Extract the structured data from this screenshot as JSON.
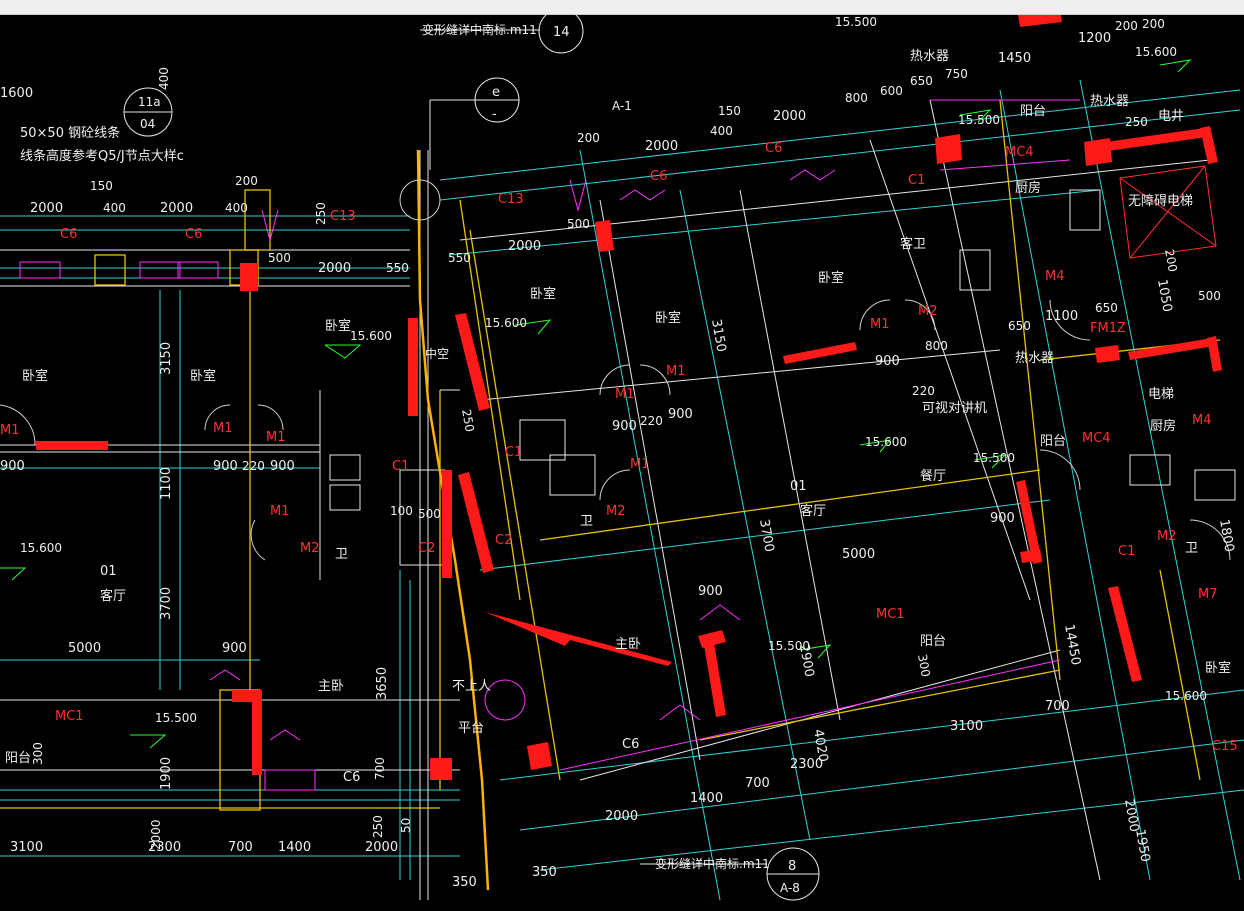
{
  "window": {
    "title": ""
  },
  "drawing": {
    "annotations": {
      "detail_top": "变形缝详中南标.m11",
      "detail_bottom": "变形缝详中南标.m11",
      "bubble_14": "14",
      "bubble_e": "e",
      "bubble_e_sub": "-",
      "bubble_11a": "11a",
      "bubble_04": "04",
      "bubble_8": "8",
      "bubble_a8": "A-8",
      "a1": "A-1",
      "note_line1": "50×50 钢砼线条",
      "note_line2": "线条高度参考Q5/J节点大样c"
    },
    "rooms": {
      "bedroom": "卧室",
      "living": "客厅",
      "kitchen": "厨房",
      "balcony": "阳台",
      "master": "主卧",
      "dining": "餐厅",
      "guest_bath": "客卫",
      "bath": "卫",
      "void": "中空",
      "no_roof": "不上人",
      "platform": "平台",
      "water_heater": "热水器",
      "pipe_shaft": "电井",
      "elevator": "无障碍电梯",
      "elevator_short": "电梯",
      "intercom": "可视对讲机",
      "unit_01": "01"
    },
    "tags": {
      "C6": "C6",
      "C13": "C13",
      "C1": "C1",
      "C2": "C2",
      "C15": "C15",
      "M1": "M1",
      "M2": "M2",
      "M4": "M4",
      "MC1": "MC1",
      "MC4": "MC4",
      "FM1Z": "FM1Z",
      "M7": "M7"
    },
    "levels": {
      "l15600": "15.600",
      "l15500": "15.500"
    },
    "dims": {
      "d1600": "1600",
      "d150": "150",
      "d200": "200",
      "d2000": "2000",
      "d400": "400",
      "d500": "500",
      "d550": "550",
      "d3150": "3150",
      "d1100": "1100",
      "d900": "900",
      "d220": "220",
      "d800": "800",
      "d3700": "3700",
      "d5000": "5000",
      "d1900": "1900",
      "d3100": "3100",
      "d2300": "2300",
      "d700": "700",
      "d1400": "1400",
      "d3650": "3650",
      "d250": "250",
      "d50": "50",
      "d100": "100",
      "d350": "350",
      "d600": "600",
      "d1450": "1450",
      "d650": "650",
      "d750": "750",
      "d1200": "1200",
      "d1050": "1050",
      "d1950": "1950",
      "d14450": "14450",
      "d300": "300",
      "d1800": "1800",
      "d2900": "2900",
      "d4020": "4020"
    }
  }
}
